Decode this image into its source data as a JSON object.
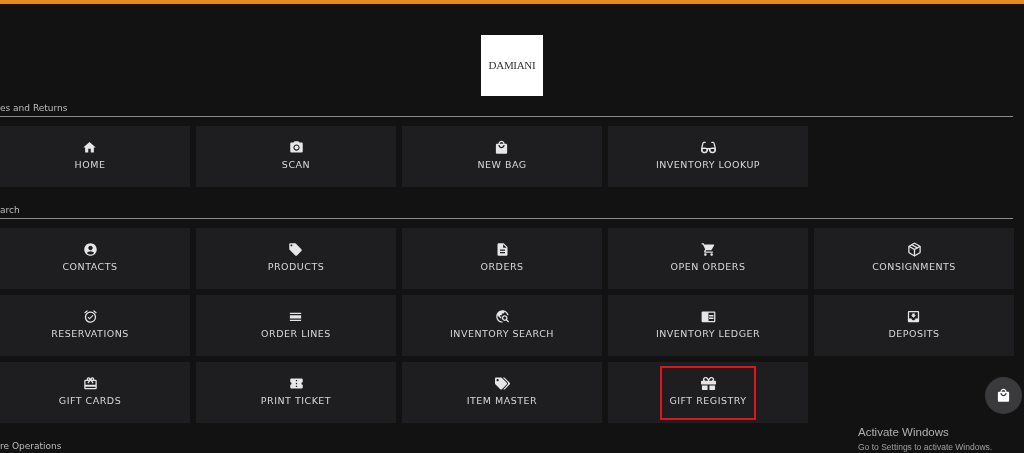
{
  "logo": {
    "text": "DAMIANI"
  },
  "sections": [
    {
      "title": "es and Returns",
      "rows": [
        [
          {
            "label": "HOME",
            "highlighted": false
          },
          {
            "label": "SCAN",
            "highlighted": false
          },
          {
            "label": "NEW BAG",
            "highlighted": false
          },
          {
            "label": "INVENTORY LOOKUP",
            "highlighted": false
          }
        ]
      ]
    },
    {
      "title": "arch",
      "rows": [
        [
          {
            "label": "CONTACTS",
            "highlighted": false
          },
          {
            "label": "PRODUCTS",
            "highlighted": false
          },
          {
            "label": "ORDERS",
            "highlighted": false
          },
          {
            "label": "OPEN ORDERS",
            "highlighted": false
          },
          {
            "label": "CONSIGNMENTS",
            "highlighted": false
          }
        ],
        [
          {
            "label": "RESERVATIONS",
            "highlighted": false
          },
          {
            "label": "ORDER LINES",
            "highlighted": false
          },
          {
            "label": "INVENTORY SEARCH",
            "highlighted": false
          },
          {
            "label": "INVENTORY LEDGER",
            "highlighted": false
          },
          {
            "label": "DEPOSITS",
            "highlighted": false
          }
        ],
        [
          {
            "label": "GIFT CARDS",
            "highlighted": false
          },
          {
            "label": "PRINT TICKET",
            "highlighted": false
          },
          {
            "label": "ITEM MASTER",
            "highlighted": false
          },
          {
            "label": "GIFT REGISTRY",
            "highlighted": true
          }
        ]
      ]
    },
    {
      "title": "re Operations"
    }
  ],
  "activation_notice": {
    "title": "Activate Windows",
    "subtitle": "Go to Settings to activate Windows."
  }
}
